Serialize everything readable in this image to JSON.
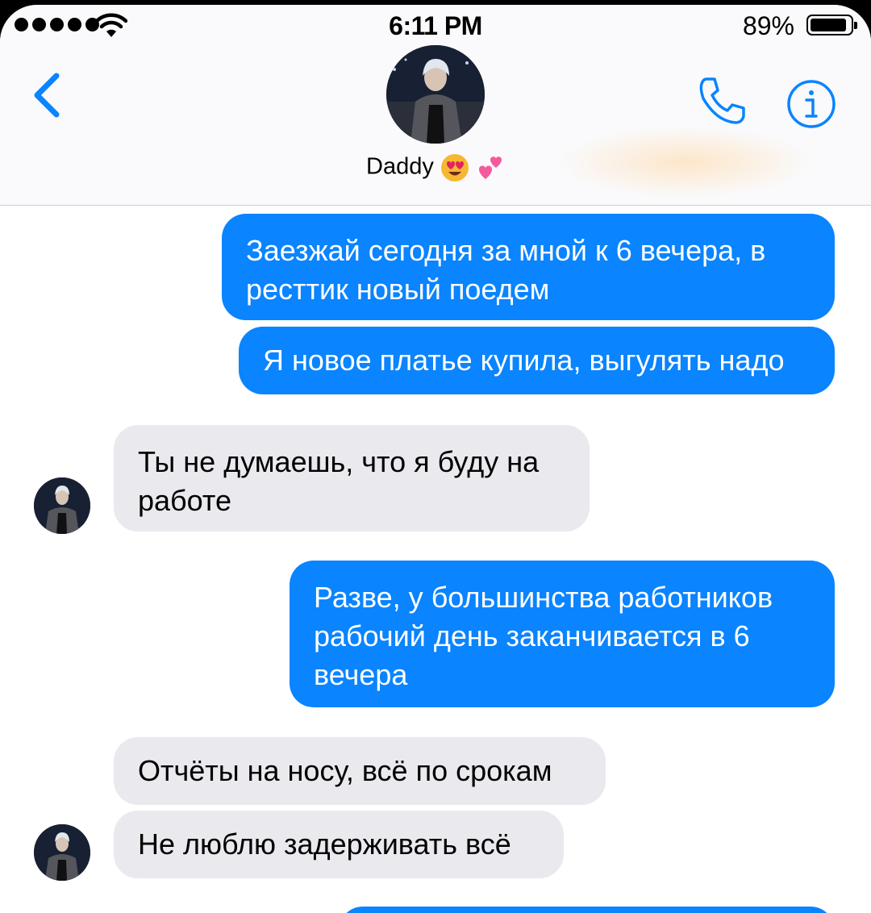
{
  "status_bar": {
    "time": "6:11 PM",
    "battery_percent": "89%",
    "battery_level": 0.89
  },
  "header": {
    "contact_name": "Daddy",
    "back_icon": "chevron-left-icon",
    "call_icon": "phone-icon",
    "info_icon": "info-icon"
  },
  "colors": {
    "accent": "#0a84ff",
    "incoming_bubble": "#e9e9ee"
  },
  "messages": [
    {
      "direction": "outgoing",
      "text": "Заезжай сегодня за мной к 6 вечера, в ресттик новый поедем"
    },
    {
      "direction": "outgoing",
      "text": "Я новое платье купила, выгулять надо"
    },
    {
      "direction": "incoming",
      "text": "Ты не думаешь, что я буду на работе"
    },
    {
      "direction": "outgoing",
      "text": "Разве, у большинства работников рабочий день заканчивается в 6 вечера"
    },
    {
      "direction": "incoming",
      "text": "Отчёты на носу, всё по срокам"
    },
    {
      "direction": "incoming",
      "text": "Не люблю задерживать всё"
    }
  ]
}
